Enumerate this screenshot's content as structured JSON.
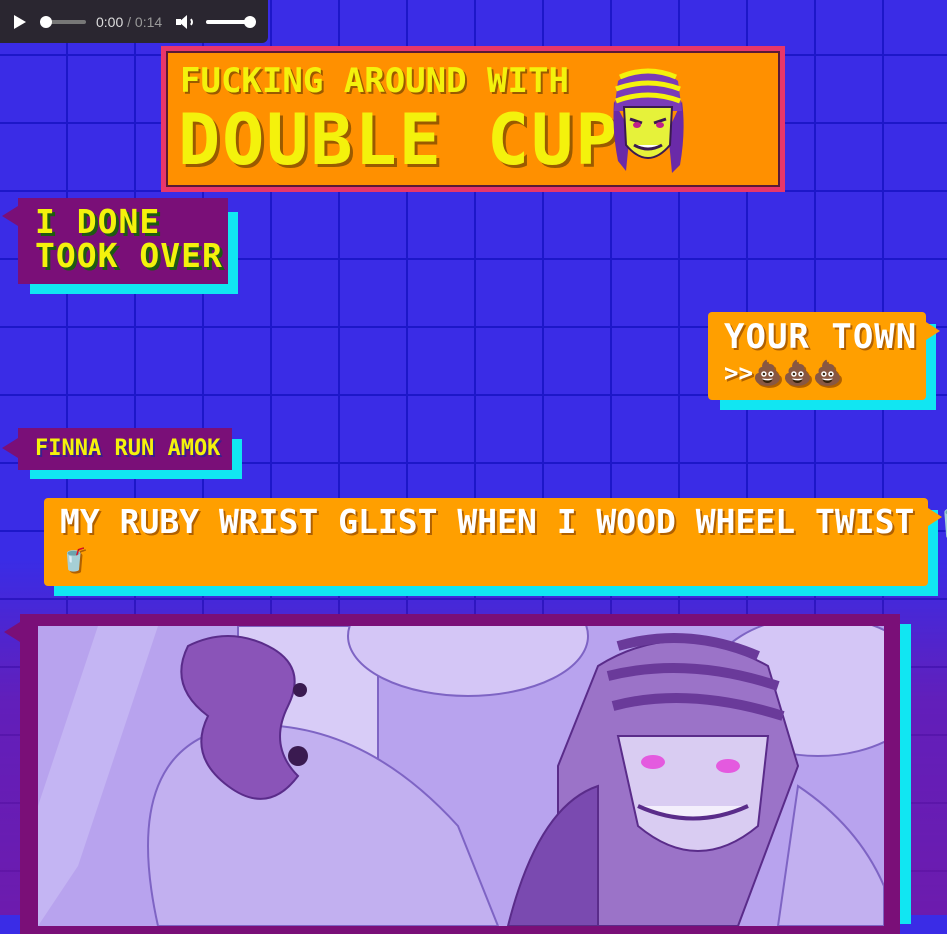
{
  "audio": {
    "current_time": "0:00",
    "separator": " / ",
    "duration": "0:14",
    "progress": 0.0,
    "volume": 1.0
  },
  "header": {
    "subtitle": "FUCKING AROUND WITH",
    "title": "DOUBLE CUP"
  },
  "messages": [
    {
      "id": "m1",
      "side": "left",
      "style": "purple",
      "lines": [
        "I DONE",
        "TOOK OVER"
      ]
    },
    {
      "id": "m2",
      "side": "right",
      "style": "orange",
      "text": "YOUR TOWN",
      "text2": ">>💩💩💩"
    },
    {
      "id": "m3",
      "side": "left",
      "style": "purple",
      "text": "FINNA RUN AMOK"
    },
    {
      "id": "m4",
      "side": "right",
      "style": "orange",
      "text": "MY RUBY WRIST GLIST WHEN I WOOD WHEEL TWIST 🥤",
      "text2": "🥤"
    }
  ],
  "colors": {
    "background": "#3a2ce6",
    "grid": "#1d17c9",
    "bubble_purple": "#7a0f78",
    "bubble_orange": "#ff9f00",
    "bubble_shadow": "#11e6f2",
    "title_yellow": "#f4f20c",
    "header_border": "#e8366a"
  },
  "icons": [
    "play-icon",
    "volume-icon",
    "mascot-image",
    "comic-art-image"
  ]
}
